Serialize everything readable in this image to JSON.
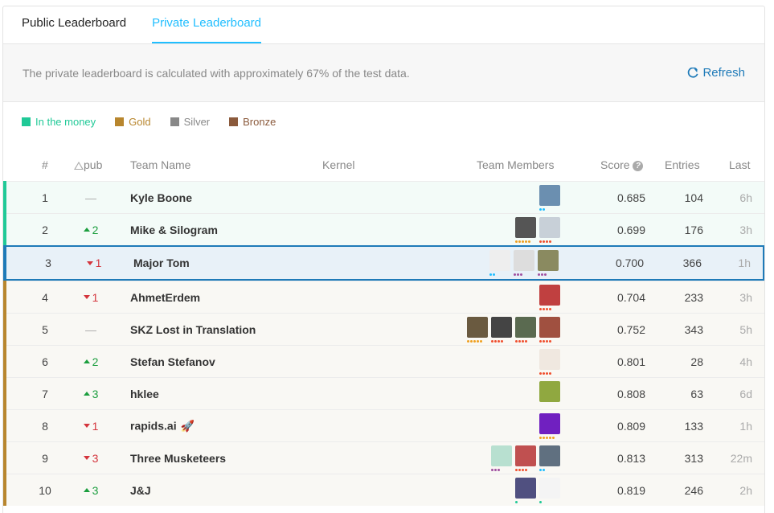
{
  "tabs": [
    {
      "label": "Public Leaderboard",
      "active": false
    },
    {
      "label": "Private Leaderboard",
      "active": true
    }
  ],
  "info": {
    "text": "The private leaderboard is calculated with approximately 67% of the test data.",
    "refresh_label": "Refresh"
  },
  "legend": [
    {
      "label": "In the money",
      "color": "#20c997"
    },
    {
      "label": "Gold",
      "color": "#b8862e"
    },
    {
      "label": "Silver",
      "color": "#888888"
    },
    {
      "label": "Bronze",
      "color": "#8b5a3c"
    }
  ],
  "columns": {
    "rank": "#",
    "delta": "pub",
    "team": "Team Name",
    "kernel": "Kernel",
    "members": "Team Members",
    "score": "Score",
    "entries": "Entries",
    "last": "Last"
  },
  "rows": [
    {
      "rank": "1",
      "delta": "—",
      "dir": "flat",
      "team": "Kyle Boone",
      "score": "0.685",
      "entries": "104",
      "last": "6h",
      "tier": "money",
      "members": [
        {
          "c": "#6b8fb0",
          "dots": [
            "#20beff",
            "#20beff"
          ]
        }
      ]
    },
    {
      "rank": "2",
      "delta": "2",
      "dir": "up",
      "team": "Mike & Silogram",
      "score": "0.699",
      "entries": "176",
      "last": "3h",
      "tier": "money",
      "members": [
        {
          "c": "#555",
          "dots": [
            "#f0a020",
            "#f0a020",
            "#f0a020",
            "#f0a020",
            "#f0a020"
          ]
        },
        {
          "c": "#c8d0d8",
          "dots": [
            "#f05030",
            "#f05030",
            "#f05030",
            "#f05030"
          ]
        }
      ]
    },
    {
      "rank": "3",
      "delta": "1",
      "dir": "down",
      "team": "Major Tom",
      "score": "0.700",
      "entries": "366",
      "last": "1h",
      "tier": "highlight",
      "members": [
        {
          "c": "#eee",
          "dots": [
            "#20beff",
            "#20beff"
          ]
        },
        {
          "c": "#ddd",
          "dots": [
            "#a050a0",
            "#a050a0",
            "#a050a0"
          ]
        },
        {
          "c": "#8a8a60",
          "dots": [
            "#a050a0",
            "#a050a0",
            "#a050a0"
          ]
        }
      ]
    },
    {
      "rank": "4",
      "delta": "1",
      "dir": "down",
      "team": "AhmetErdem",
      "score": "0.704",
      "entries": "233",
      "last": "3h",
      "tier": "gold",
      "members": [
        {
          "c": "#c04040",
          "dots": [
            "#f05030",
            "#f05030",
            "#f05030",
            "#f05030"
          ]
        }
      ]
    },
    {
      "rank": "5",
      "delta": "—",
      "dir": "flat",
      "team": "SKZ Lost in Translation",
      "score": "0.752",
      "entries": "343",
      "last": "5h",
      "tier": "gold",
      "members": [
        {
          "c": "#6a5a40",
          "dots": [
            "#f0a020",
            "#f0a020",
            "#f0a020",
            "#f0a020",
            "#f0a020"
          ]
        },
        {
          "c": "#444",
          "dots": [
            "#f05030",
            "#f05030",
            "#f05030",
            "#f05030"
          ]
        },
        {
          "c": "#5a6a50",
          "dots": [
            "#f05030",
            "#f05030",
            "#f05030",
            "#f05030"
          ]
        },
        {
          "c": "#a05040",
          "dots": [
            "#f05030",
            "#f05030",
            "#f05030",
            "#f05030"
          ]
        }
      ]
    },
    {
      "rank": "6",
      "delta": "2",
      "dir": "up",
      "team": "Stefan Stefanov",
      "score": "0.801",
      "entries": "28",
      "last": "4h",
      "tier": "gold",
      "members": [
        {
          "c": "#f0e8e0",
          "dots": [
            "#f05030",
            "#f05030",
            "#f05030",
            "#f05030"
          ]
        }
      ]
    },
    {
      "rank": "7",
      "delta": "3",
      "dir": "up",
      "team": "hklee",
      "score": "0.808",
      "entries": "63",
      "last": "6d",
      "tier": "gold",
      "members": [
        {
          "c": "#90a840",
          "dots": []
        }
      ]
    },
    {
      "rank": "8",
      "delta": "1",
      "dir": "down",
      "team": "rapids.ai",
      "rocket": "🚀",
      "score": "0.809",
      "entries": "133",
      "last": "1h",
      "tier": "gold",
      "members": [
        {
          "c": "#7020c0",
          "dots": [
            "#f0a020",
            "#f0a020",
            "#f0a020",
            "#f0a020",
            "#f0a020"
          ]
        }
      ]
    },
    {
      "rank": "9",
      "delta": "3",
      "dir": "down",
      "team": "Three Musketeers",
      "score": "0.813",
      "entries": "313",
      "last": "22m",
      "tier": "gold",
      "members": [
        {
          "c": "#b8e0d0",
          "dots": [
            "#a050a0",
            "#a050a0",
            "#a050a0"
          ]
        },
        {
          "c": "#c05050",
          "dots": [
            "#f05030",
            "#f05030",
            "#f05030",
            "#f05030"
          ]
        },
        {
          "c": "#607080",
          "dots": [
            "#20beff",
            "#20beff"
          ]
        }
      ]
    },
    {
      "rank": "10",
      "delta": "3",
      "dir": "up",
      "team": "J&J",
      "score": "0.819",
      "entries": "246",
      "last": "2h",
      "tier": "gold",
      "members": [
        {
          "c": "#505080",
          "dots": [
            "#20c997"
          ]
        },
        {
          "c": "#f4f4f4",
          "dots": [
            "#20c997"
          ]
        }
      ]
    }
  ]
}
